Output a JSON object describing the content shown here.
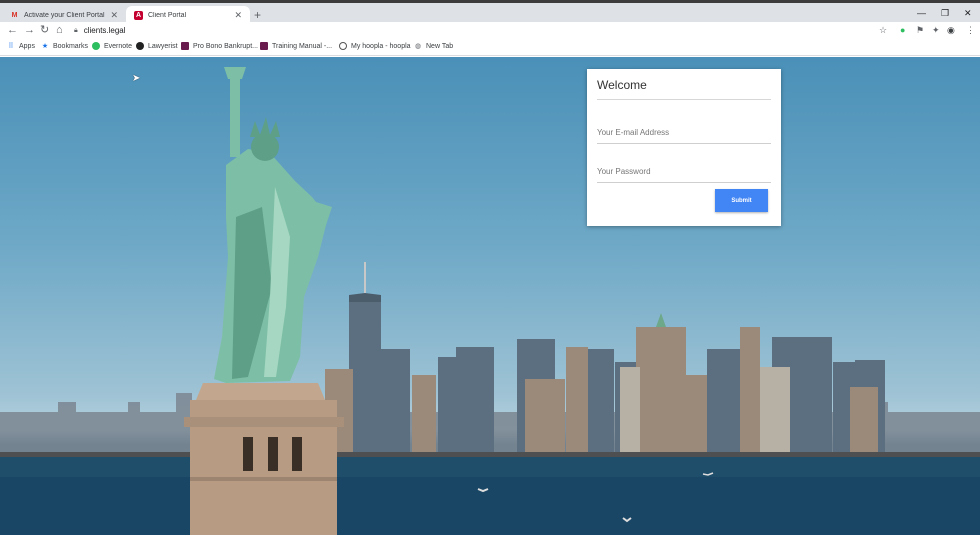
{
  "browser": {
    "tabs": [
      {
        "title": "Activate your Client Portal accou",
        "icon": "gmail-icon",
        "active": false
      },
      {
        "title": "Client Portal",
        "icon": "angular-icon",
        "active": true
      }
    ],
    "address": "clients.legal",
    "bookmarks": [
      {
        "label": "Apps",
        "icon": "apps-grid-icon"
      },
      {
        "label": "Bookmarks",
        "icon": "star-icon"
      },
      {
        "label": "Evernote",
        "icon": "evernote-icon"
      },
      {
        "label": "Lawyerist",
        "icon": "lawyerist-icon"
      },
      {
        "label": "Pro Bono Bankrupt...",
        "icon": "bookmark-page-icon"
      },
      {
        "label": "Training Manual -...",
        "icon": "bookmark-page-icon"
      },
      {
        "label": "My hoopla - hoopla",
        "icon": "hoopla-icon"
      },
      {
        "label": "New Tab",
        "icon": "globe-icon"
      }
    ]
  },
  "login": {
    "title": "Welcome",
    "email_placeholder": "Your E-mail Address",
    "password_placeholder": "Your Password",
    "submit_label": "Submit"
  },
  "colors": {
    "accent": "#4285f4",
    "sky": "#6fa9c7",
    "water": "#1f4e6b"
  }
}
